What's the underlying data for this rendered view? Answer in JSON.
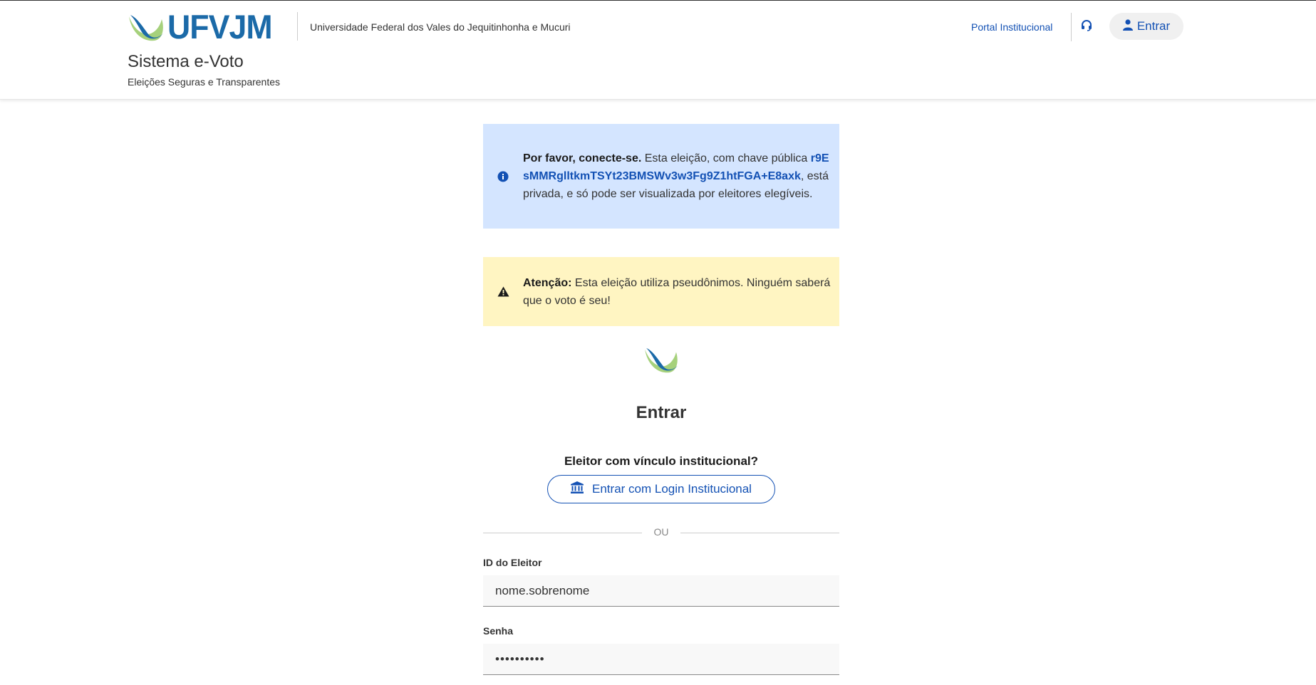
{
  "header": {
    "logo_text": "UFVJM",
    "university_name": "Universidade Federal dos Vales do Jequitinhonha e Mucuri",
    "system_title": "Sistema e-Voto",
    "system_subtitle": "Eleições Seguras e Transparentes",
    "portal_link": "Portal Institucional",
    "support_icon": "headset-icon",
    "login_label": "Entrar",
    "login_icon": "user-icon"
  },
  "colors": {
    "primary": "#1351b4",
    "logo_blue": "#1b6aa8",
    "logo_green": "#a6d17c",
    "info_bg": "#d4e5ff",
    "warning_bg": "#fff5c2"
  },
  "alerts": {
    "info": {
      "icon": "info-icon",
      "title": "Por favor, conecte-se.",
      "text_before": " Esta eleição, com chave pública ",
      "public_key": "r9EsMMRglltkmTSYt23BMSWv3w3Fg9Z1htFGA+E8axk",
      "text_after": ", está privada, e só pode ser visualizada por eleitores elegíveis."
    },
    "warning": {
      "icon": "warning-icon",
      "title": "Atenção:",
      "text": " Esta eleição utiliza pseudônimos. Ninguém saberá que o voto é seu!"
    }
  },
  "form": {
    "title": "Entrar",
    "institutional_question": "Eleitor com vínculo institucional?",
    "institutional_button": "Entrar com Login Institucional",
    "institutional_icon": "bank-icon",
    "or_text": "OU",
    "voter_id_label": "ID do Eleitor",
    "voter_id_value": "nome.sobrenome",
    "password_label": "Senha",
    "password_value": "••••••••••"
  }
}
